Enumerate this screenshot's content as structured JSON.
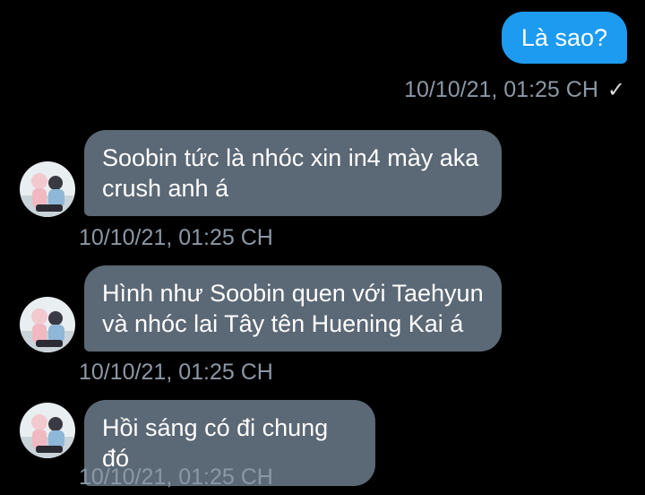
{
  "conversation": {
    "sent": [
      {
        "text": "Là sao?",
        "time": "10/10/21, 01:25 CH",
        "status_icon": "checkmark-icon",
        "status_glyph": "✓"
      }
    ],
    "received": [
      {
        "line1": "Soobin tức là nhóc xin in4 mày aka",
        "line2": "crush anh á",
        "time": "10/10/21, 01:25 CH"
      },
      {
        "line1": "Hình như Soobin quen với Taehyun",
        "line2": "và nhóc lai Tây tên Huening Kai á",
        "time": "10/10/21, 01:25 CH"
      },
      {
        "line1": "Hồi sáng có đi chung đó",
        "time": "10/10/21, 01:25 CH"
      }
    ]
  },
  "colors": {
    "background": "#000000",
    "sent_bubble": "#1d9bf0",
    "received_bubble": "#5b6875",
    "timestamp": "#8b98a5"
  }
}
